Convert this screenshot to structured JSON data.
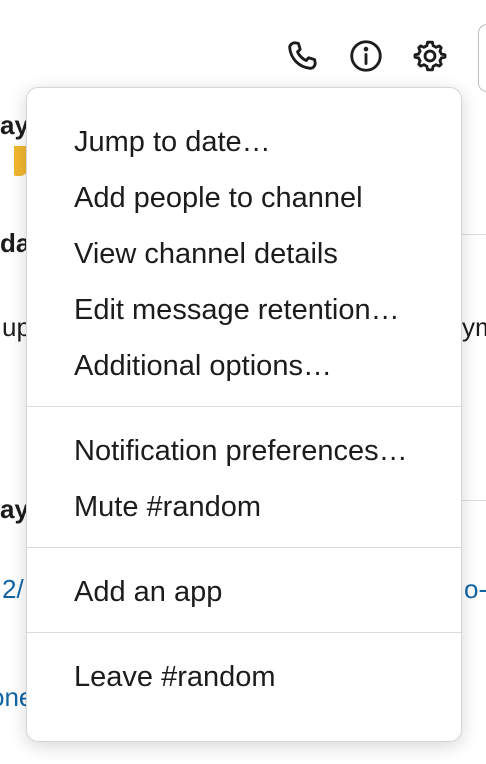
{
  "header": {
    "icons": [
      "phone-icon",
      "info-icon",
      "gear-icon"
    ]
  },
  "background": {
    "frag_day_1": "ay,",
    "frag_day_2": "da",
    "frag_up": "up",
    "frag_right_ym": "ym",
    "frag_day_3": "ay,",
    "frag_link_2": "2/",
    "frag_link_o": "o-",
    "frag_link_one": "one"
  },
  "menu": {
    "jump_to_date": "Jump to date…",
    "add_people": "Add people to channel",
    "view_details": "View channel details",
    "edit_retention": "Edit message retention…",
    "additional_options": "Additional options…",
    "notification_prefs": "Notification preferences…",
    "mute_channel": "Mute #random",
    "add_app": "Add an app",
    "leave_channel": "Leave #random"
  }
}
